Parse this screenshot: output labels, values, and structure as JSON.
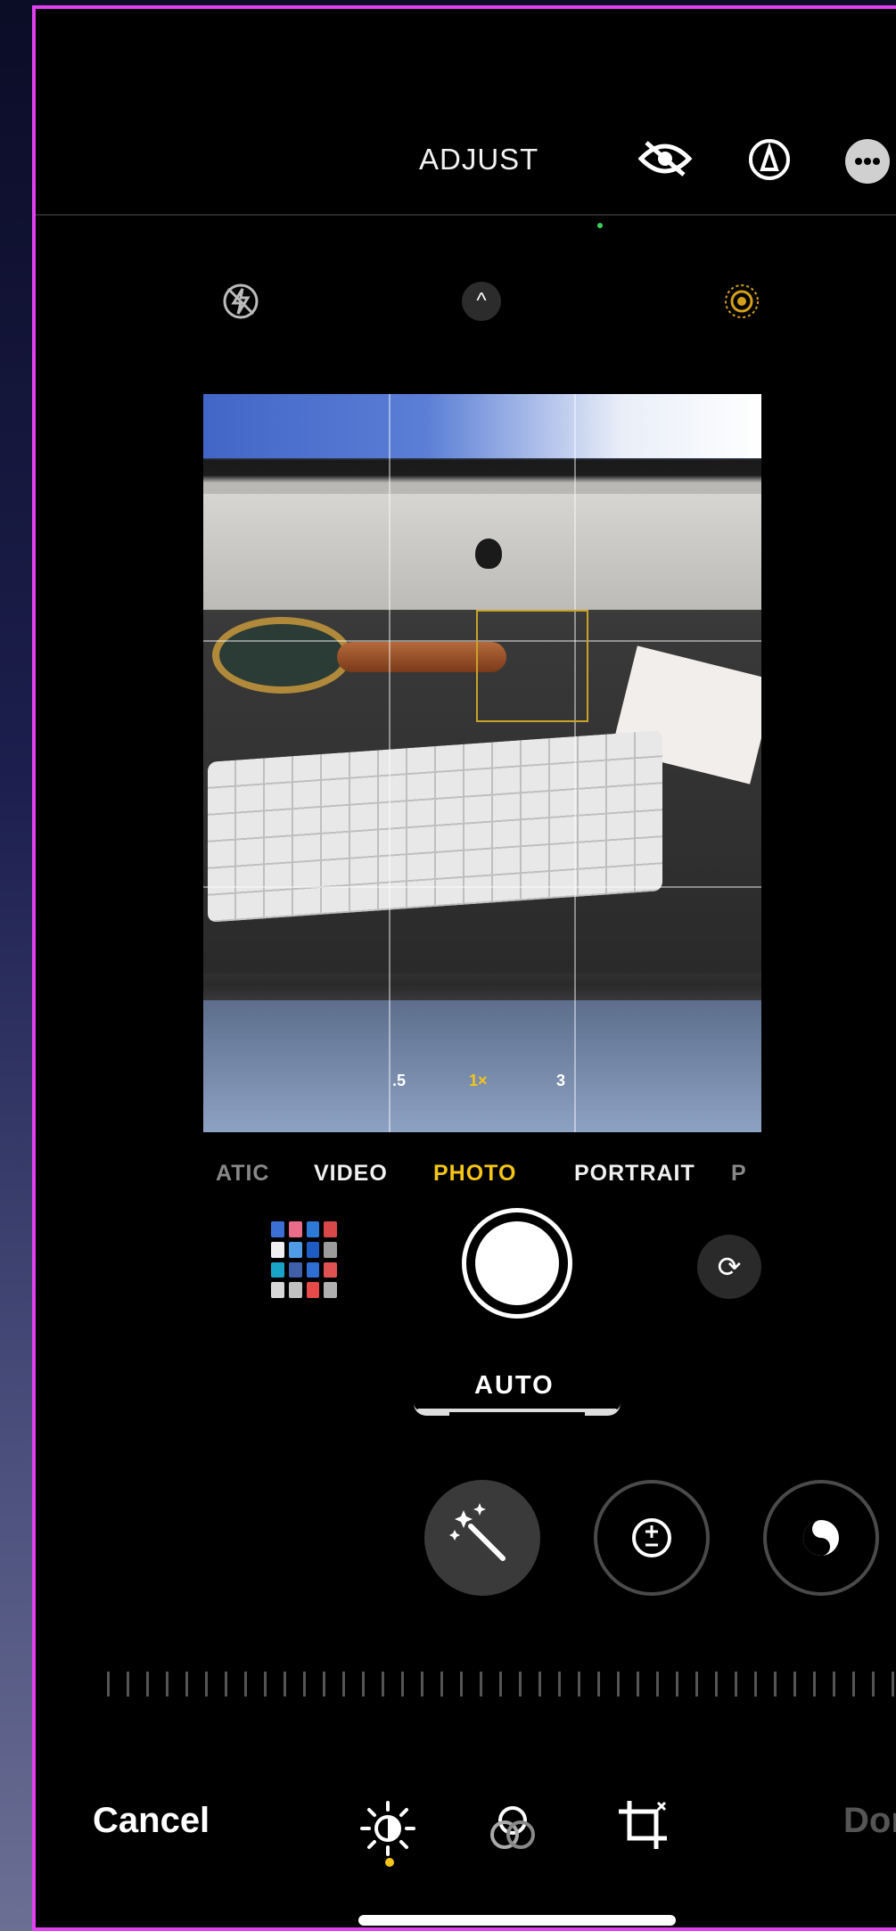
{
  "header": {
    "title": "ADJUST",
    "icons": [
      "eye-slash-icon",
      "markup-icon",
      "more-icon"
    ]
  },
  "camera": {
    "top_icons": [
      "flash-off-icon",
      "chevron-up-icon",
      "live-photo-icon"
    ],
    "zoom_options": [
      ".5",
      "1×",
      "3"
    ],
    "active_zoom": "1×",
    "modes": [
      "ATIC",
      "VIDEO",
      "PHOTO",
      "PORTRAIT",
      "P"
    ],
    "active_mode": "PHOTO"
  },
  "adjust": {
    "auto_label": "AUTO",
    "tools": [
      "magic-wand-icon",
      "exposure-icon",
      "brilliance-icon"
    ]
  },
  "footer": {
    "cancel_label": "Cancel",
    "done_label": "Done",
    "icons": [
      "adjust-icon",
      "filters-icon",
      "crop-icon"
    ]
  },
  "colors": {
    "accent": "#f5c518",
    "frame_border": "#e040f0",
    "done_disabled": "#555555"
  }
}
